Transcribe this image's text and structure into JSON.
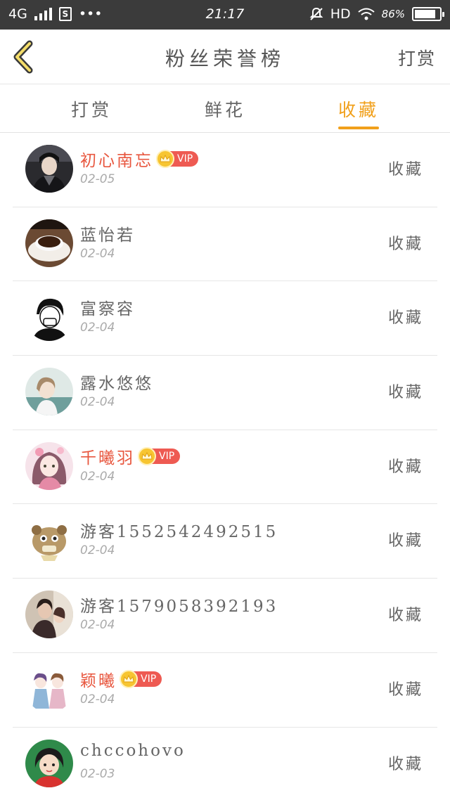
{
  "status_bar": {
    "network": "4G",
    "time": "21:17",
    "hd": "HD",
    "battery_percent": "86%",
    "battery_level": 0.86
  },
  "header": {
    "title": "粉丝荣誉榜",
    "action": "打赏"
  },
  "tabs": [
    {
      "label": "打赏",
      "active": false
    },
    {
      "label": "鲜花",
      "active": false
    },
    {
      "label": "收藏",
      "active": true
    }
  ],
  "vip_label": "VIP",
  "fans": [
    {
      "name": "初心南忘",
      "date": "02-05",
      "vip": true,
      "action": "收藏",
      "avatar": "avatar-dark-costume"
    },
    {
      "name": "蓝怡若",
      "date": "02-04",
      "vip": false,
      "action": "收藏",
      "avatar": "avatar-coffee-cup"
    },
    {
      "name": "富察容",
      "date": "02-04",
      "vip": false,
      "action": "收藏",
      "avatar": "avatar-sketch-boy"
    },
    {
      "name": "露水悠悠",
      "date": "02-04",
      "vip": false,
      "action": "收藏",
      "avatar": "avatar-girl-sea"
    },
    {
      "name": "千曦羽",
      "date": "02-04",
      "vip": true,
      "action": "收藏",
      "avatar": "avatar-anime-girl"
    },
    {
      "name": "游客1552542492515",
      "date": "02-04",
      "vip": false,
      "action": "收藏",
      "avatar": "avatar-cartoon-hamster"
    },
    {
      "name": "游客1579058392193",
      "date": "02-04",
      "vip": false,
      "action": "收藏",
      "avatar": "avatar-couple-photo"
    },
    {
      "name": "颖曦",
      "date": "02-04",
      "vip": true,
      "action": "收藏",
      "avatar": "avatar-anime-pair"
    },
    {
      "name": "chccohovo",
      "date": "02-03",
      "vip": false,
      "action": "收藏",
      "avatar": "avatar-cartoon-girl-green"
    }
  ],
  "colors": {
    "accent": "#f1a01b",
    "vip_name": "#e8573f",
    "vip_badge": "#ee5a52",
    "status_bar": "#3b3b3b"
  }
}
